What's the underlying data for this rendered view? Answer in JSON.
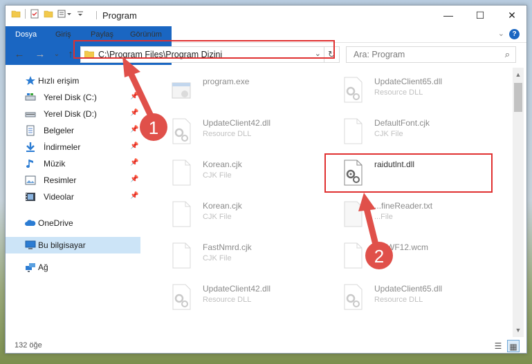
{
  "window": {
    "title": "Program",
    "controls": {
      "minimize": "—",
      "maximize": "☐",
      "close": "✕"
    }
  },
  "ribbon": {
    "tabs": [
      "Dosya",
      "Giriş",
      "Paylaş",
      "Görünüm"
    ],
    "help": "?"
  },
  "address_bar": {
    "path": "C:\\Program Files\\Program Dizini",
    "search_placeholder": "Ara: Program"
  },
  "sidebar": {
    "items": [
      {
        "label": "Hızlı erişim",
        "icon": "star-icon",
        "pinned": false
      },
      {
        "label": "Yerel Disk (C:)",
        "icon": "drive-icon",
        "pinned": true
      },
      {
        "label": "Yerel Disk (D:)",
        "icon": "drive-icon",
        "pinned": true
      },
      {
        "label": "Belgeler",
        "icon": "documents-icon",
        "pinned": true
      },
      {
        "label": "İndirmeler",
        "icon": "download-icon",
        "pinned": true
      },
      {
        "label": "Müzik",
        "icon": "music-icon",
        "pinned": true
      },
      {
        "label": "Resimler",
        "icon": "pictures-icon",
        "pinned": true
      },
      {
        "label": "Videolar",
        "icon": "videos-icon",
        "pinned": true
      },
      {
        "label": "OneDrive",
        "icon": "cloud-icon",
        "pinned": false
      },
      {
        "label": "Bu bilgisayar",
        "icon": "computer-icon",
        "pinned": false
      },
      {
        "label": "Ağ",
        "icon": "network-icon",
        "pinned": false
      }
    ]
  },
  "files": [
    {
      "name": "program.exe",
      "type": "",
      "icon": "exe-icon",
      "highlighted": false
    },
    {
      "name": "UpdateClient65.dll",
      "type": "Resource DLL",
      "icon": "dll-gear-icon",
      "highlighted": false
    },
    {
      "name": "UpdateClient42.dll",
      "type": "Resource DLL",
      "icon": "dll-gear-icon",
      "highlighted": false
    },
    {
      "name": "DefaultFont.cjk",
      "type": "CJK File",
      "icon": "blank-file-icon",
      "highlighted": false
    },
    {
      "name": "Korean.cjk",
      "type": "CJK File",
      "icon": "blank-file-icon",
      "highlighted": false
    },
    {
      "name": "raidutlnt.dll",
      "type": "",
      "icon": "dll-gear-icon",
      "highlighted": true
    },
    {
      "name": "Korean.cjk",
      "type": "CJK File",
      "icon": "blank-file-icon",
      "highlighted": false
    },
    {
      "name": "...fineReader.txt",
      "type": "...File",
      "icon": "blank-file-icon",
      "highlighted": false
    },
    {
      "name": "FastNmrd.cjk",
      "type": "CJK File",
      "icon": "blank-file-icon",
      "highlighted": false
    },
    {
      "name": "S...WF12.wcm",
      "type": "...File",
      "icon": "blank-file-icon",
      "highlighted": false
    },
    {
      "name": "UpdateClient42.dll",
      "type": "Resource DLL",
      "icon": "dll-gear-icon",
      "highlighted": false
    },
    {
      "name": "UpdateClient65.dll",
      "type": "Resource DLL",
      "icon": "dll-gear-icon",
      "highlighted": false
    }
  ],
  "status": {
    "item_count": "132 öğe"
  },
  "annotations": [
    {
      "number": "1"
    },
    {
      "number": "2"
    }
  ],
  "colors": {
    "accent": "#1a66c2",
    "highlight_border": "#e03030",
    "arrow": "#e0504a",
    "selected_bg": "#cce4f7"
  }
}
